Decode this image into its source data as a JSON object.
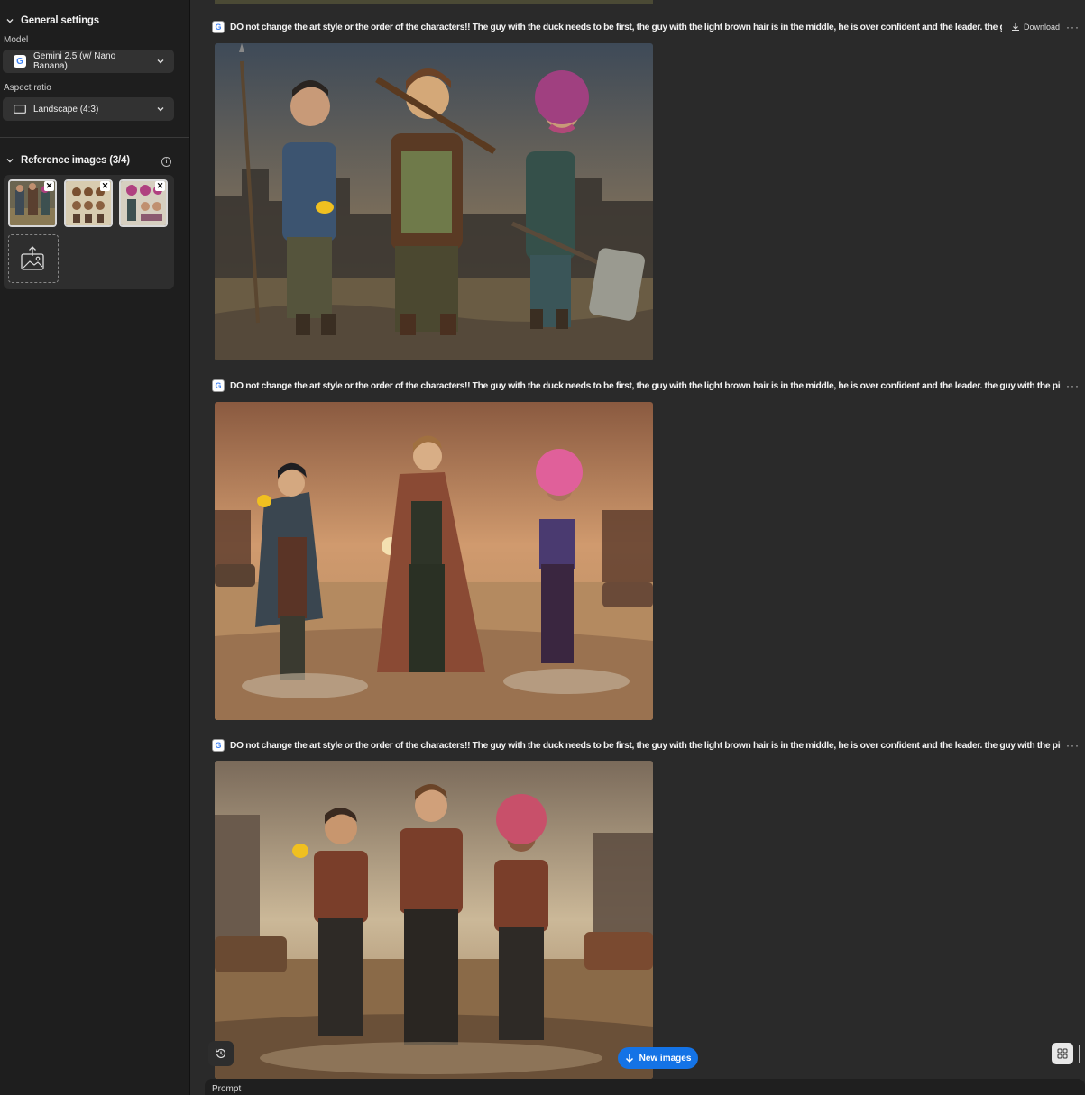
{
  "sidebar": {
    "general_settings": "General settings",
    "model_label": "Model",
    "model_value": "Gemini 2.5 (w/ Nano Banana)",
    "aspect_label": "Aspect ratio",
    "aspect_value": "Landscape (4:3)",
    "reference_title": "Reference images (3/4)"
  },
  "results": [
    {
      "prompt": "DO not change the art style or the order of the characters!! The guy with the duck needs to be first, the guy with the light brown hair is in the middle, he is over confident and the leader. the g",
      "download_label": "Download"
    },
    {
      "prompt": "DO not change the art style or the order of the characters!! The guy with the duck needs to be first, the guy with the light brown hair is in the middle, he is over confident and the leader. the guy with the pin"
    },
    {
      "prompt": "DO not change the art style or the order of the characters!! The guy with the duck needs to be first, the guy with the light brown hair is in the middle, he is over confident and the leader. the guy with the pin"
    }
  ],
  "footer": {
    "new_images_label": "New images",
    "prompt_label": "Prompt"
  },
  "colors": {
    "accent": "#1473e6",
    "sidebar_bg": "#1e1e1e",
    "main_bg": "#2a2a2a"
  }
}
